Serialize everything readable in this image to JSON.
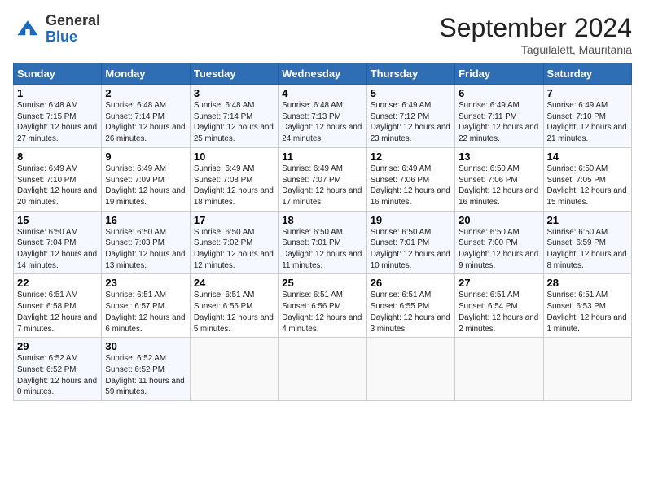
{
  "header": {
    "logo_general": "General",
    "logo_blue": "Blue",
    "month_title": "September 2024",
    "location": "Taguilalett, Mauritania"
  },
  "days_of_week": [
    "Sunday",
    "Monday",
    "Tuesday",
    "Wednesday",
    "Thursday",
    "Friday",
    "Saturday"
  ],
  "weeks": [
    [
      {
        "day": "1",
        "sunrise": "6:48 AM",
        "sunset": "7:15 PM",
        "daylight": "12 hours and 27 minutes."
      },
      {
        "day": "2",
        "sunrise": "6:48 AM",
        "sunset": "7:14 PM",
        "daylight": "12 hours and 26 minutes."
      },
      {
        "day": "3",
        "sunrise": "6:48 AM",
        "sunset": "7:14 PM",
        "daylight": "12 hours and 25 minutes."
      },
      {
        "day": "4",
        "sunrise": "6:48 AM",
        "sunset": "7:13 PM",
        "daylight": "12 hours and 24 minutes."
      },
      {
        "day": "5",
        "sunrise": "6:49 AM",
        "sunset": "7:12 PM",
        "daylight": "12 hours and 23 minutes."
      },
      {
        "day": "6",
        "sunrise": "6:49 AM",
        "sunset": "7:11 PM",
        "daylight": "12 hours and 22 minutes."
      },
      {
        "day": "7",
        "sunrise": "6:49 AM",
        "sunset": "7:10 PM",
        "daylight": "12 hours and 21 minutes."
      }
    ],
    [
      {
        "day": "8",
        "sunrise": "6:49 AM",
        "sunset": "7:10 PM",
        "daylight": "12 hours and 20 minutes."
      },
      {
        "day": "9",
        "sunrise": "6:49 AM",
        "sunset": "7:09 PM",
        "daylight": "12 hours and 19 minutes."
      },
      {
        "day": "10",
        "sunrise": "6:49 AM",
        "sunset": "7:08 PM",
        "daylight": "12 hours and 18 minutes."
      },
      {
        "day": "11",
        "sunrise": "6:49 AM",
        "sunset": "7:07 PM",
        "daylight": "12 hours and 17 minutes."
      },
      {
        "day": "12",
        "sunrise": "6:49 AM",
        "sunset": "7:06 PM",
        "daylight": "12 hours and 16 minutes."
      },
      {
        "day": "13",
        "sunrise": "6:50 AM",
        "sunset": "7:06 PM",
        "daylight": "12 hours and 16 minutes."
      },
      {
        "day": "14",
        "sunrise": "6:50 AM",
        "sunset": "7:05 PM",
        "daylight": "12 hours and 15 minutes."
      }
    ],
    [
      {
        "day": "15",
        "sunrise": "6:50 AM",
        "sunset": "7:04 PM",
        "daylight": "12 hours and 14 minutes."
      },
      {
        "day": "16",
        "sunrise": "6:50 AM",
        "sunset": "7:03 PM",
        "daylight": "12 hours and 13 minutes."
      },
      {
        "day": "17",
        "sunrise": "6:50 AM",
        "sunset": "7:02 PM",
        "daylight": "12 hours and 12 minutes."
      },
      {
        "day": "18",
        "sunrise": "6:50 AM",
        "sunset": "7:01 PM",
        "daylight": "12 hours and 11 minutes."
      },
      {
        "day": "19",
        "sunrise": "6:50 AM",
        "sunset": "7:01 PM",
        "daylight": "12 hours and 10 minutes."
      },
      {
        "day": "20",
        "sunrise": "6:50 AM",
        "sunset": "7:00 PM",
        "daylight": "12 hours and 9 minutes."
      },
      {
        "day": "21",
        "sunrise": "6:50 AM",
        "sunset": "6:59 PM",
        "daylight": "12 hours and 8 minutes."
      }
    ],
    [
      {
        "day": "22",
        "sunrise": "6:51 AM",
        "sunset": "6:58 PM",
        "daylight": "12 hours and 7 minutes."
      },
      {
        "day": "23",
        "sunrise": "6:51 AM",
        "sunset": "6:57 PM",
        "daylight": "12 hours and 6 minutes."
      },
      {
        "day": "24",
        "sunrise": "6:51 AM",
        "sunset": "6:56 PM",
        "daylight": "12 hours and 5 minutes."
      },
      {
        "day": "25",
        "sunrise": "6:51 AM",
        "sunset": "6:56 PM",
        "daylight": "12 hours and 4 minutes."
      },
      {
        "day": "26",
        "sunrise": "6:51 AM",
        "sunset": "6:55 PM",
        "daylight": "12 hours and 3 minutes."
      },
      {
        "day": "27",
        "sunrise": "6:51 AM",
        "sunset": "6:54 PM",
        "daylight": "12 hours and 2 minutes."
      },
      {
        "day": "28",
        "sunrise": "6:51 AM",
        "sunset": "6:53 PM",
        "daylight": "12 hours and 1 minute."
      }
    ],
    [
      {
        "day": "29",
        "sunrise": "6:52 AM",
        "sunset": "6:52 PM",
        "daylight": "12 hours and 0 minutes."
      },
      {
        "day": "30",
        "sunrise": "6:52 AM",
        "sunset": "6:52 PM",
        "daylight": "11 hours and 59 minutes."
      },
      null,
      null,
      null,
      null,
      null
    ]
  ]
}
